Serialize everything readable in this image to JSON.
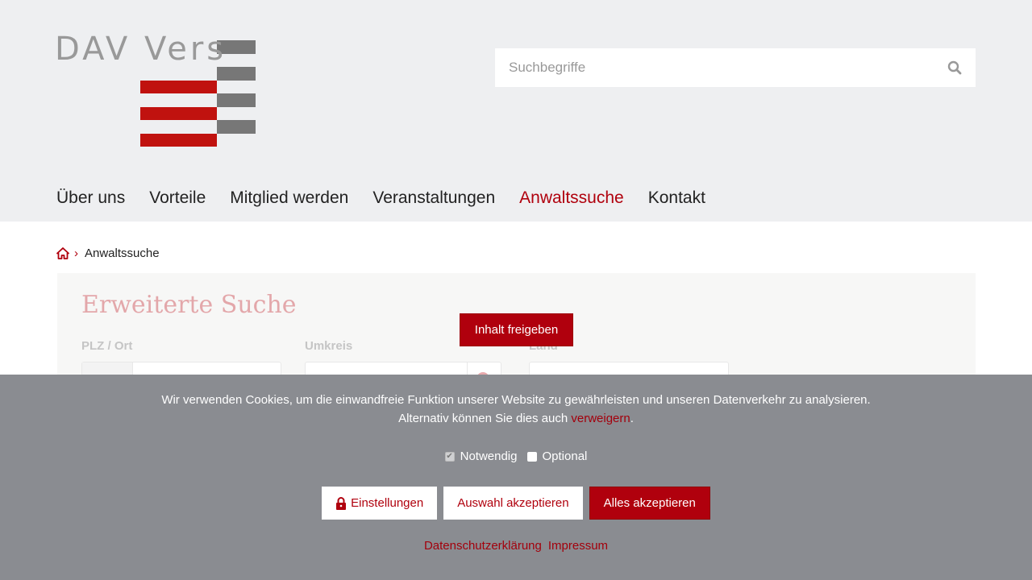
{
  "logo": {
    "text": "DAV Vers"
  },
  "search": {
    "placeholder": "Suchbegriffe",
    "icon": "search-icon"
  },
  "nav": {
    "items": [
      {
        "label": "Über uns"
      },
      {
        "label": "Vorteile"
      },
      {
        "label": "Mitglied werden"
      },
      {
        "label": "Veranstaltungen"
      },
      {
        "label": "Anwaltssuche",
        "active": true
      },
      {
        "label": "Kontakt"
      }
    ]
  },
  "breadcrumb": {
    "home_icon": "home-icon",
    "separator": "›",
    "current": "Anwaltssuche"
  },
  "search_panel": {
    "title": "Erweiterte Suche",
    "labels": {
      "plz_ort": "PLZ / Ort",
      "umkreis": "Umkreis",
      "land": "Land"
    }
  },
  "unlock_button": "Inhalt freigeben",
  "cookie": {
    "line1": "Wir verwenden Cookies, um die einwandfreie Funktion unserer Website zu gewährleisten und unseren Datenverkehr zu analysieren.",
    "line2_prefix": "Alternativ können Sie dies auch ",
    "line2_link": "verweigern",
    "line2_suffix": ".",
    "checkboxes": {
      "necessary": "Notwendig",
      "optional": "Optional"
    },
    "buttons": {
      "settings": "Einstellungen",
      "accept_selection": "Auswahl akzeptieren",
      "accept_all": "Alles akzeptieren"
    },
    "links": {
      "privacy": "Datenschutzerklärung",
      "imprint": "Impressum"
    }
  },
  "colors": {
    "accent": "#b0000d",
    "header_bg": "#eeeff1",
    "overlay": "#8a8c91"
  }
}
